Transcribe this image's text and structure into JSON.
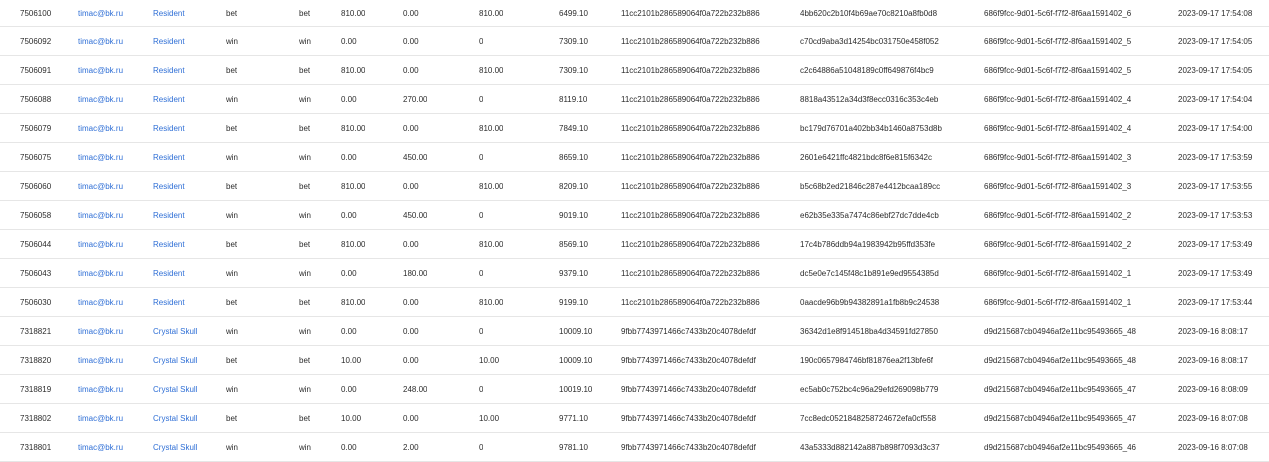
{
  "colors": {
    "link": "#2f6fd6",
    "text": "#2c2c2c",
    "divider": "#e6e6e6"
  },
  "rows": [
    {
      "id": "7506100",
      "email": "timac@bk.ru",
      "game": "Resident",
      "type": "bet",
      "action": "bet",
      "bet": "810.00",
      "win": "0.00",
      "debit": "810.00",
      "balance": "6499.10",
      "session": "11cc2101b286589064f0a722b232b886",
      "tx": "4bb620c2b10f4b69ae70c8210a8fb0d8",
      "round": "686f9fcc-9d01-5c6f-f7f2-8f6aa1591402_6",
      "date": "2023-09-17 17:54:08"
    },
    {
      "id": "7506092",
      "email": "timac@bk.ru",
      "game": "Resident",
      "type": "win",
      "action": "win",
      "bet": "0.00",
      "win": "0.00",
      "debit": "0",
      "balance": "7309.10",
      "session": "11cc2101b286589064f0a722b232b886",
      "tx": "c70cd9aba3d14254bc031750e458f052",
      "round": "686f9fcc-9d01-5c6f-f7f2-8f6aa1591402_5",
      "date": "2023-09-17 17:54:05"
    },
    {
      "id": "7506091",
      "email": "timac@bk.ru",
      "game": "Resident",
      "type": "bet",
      "action": "bet",
      "bet": "810.00",
      "win": "0.00",
      "debit": "810.00",
      "balance": "7309.10",
      "session": "11cc2101b286589064f0a722b232b886",
      "tx": "c2c64886a51048189c0ff649876f4bc9",
      "round": "686f9fcc-9d01-5c6f-f7f2-8f6aa1591402_5",
      "date": "2023-09-17 17:54:05"
    },
    {
      "id": "7506088",
      "email": "timac@bk.ru",
      "game": "Resident",
      "type": "win",
      "action": "win",
      "bet": "0.00",
      "win": "270.00",
      "debit": "0",
      "balance": "8119.10",
      "session": "11cc2101b286589064f0a722b232b886",
      "tx": "8818a43512a34d3f8ecc0316c353c4eb",
      "round": "686f9fcc-9d01-5c6f-f7f2-8f6aa1591402_4",
      "date": "2023-09-17 17:54:04"
    },
    {
      "id": "7506079",
      "email": "timac@bk.ru",
      "game": "Resident",
      "type": "bet",
      "action": "bet",
      "bet": "810.00",
      "win": "0.00",
      "debit": "810.00",
      "balance": "7849.10",
      "session": "11cc2101b286589064f0a722b232b886",
      "tx": "bc179d76701a402bb34b1460a8753d8b",
      "round": "686f9fcc-9d01-5c6f-f7f2-8f6aa1591402_4",
      "date": "2023-09-17 17:54:00"
    },
    {
      "id": "7506075",
      "email": "timac@bk.ru",
      "game": "Resident",
      "type": "win",
      "action": "win",
      "bet": "0.00",
      "win": "450.00",
      "debit": "0",
      "balance": "8659.10",
      "session": "11cc2101b286589064f0a722b232b886",
      "tx": "2601e6421ffc4821bdc8f6e815f6342c",
      "round": "686f9fcc-9d01-5c6f-f7f2-8f6aa1591402_3",
      "date": "2023-09-17 17:53:59"
    },
    {
      "id": "7506060",
      "email": "timac@bk.ru",
      "game": "Resident",
      "type": "bet",
      "action": "bet",
      "bet": "810.00",
      "win": "0.00",
      "debit": "810.00",
      "balance": "8209.10",
      "session": "11cc2101b286589064f0a722b232b886",
      "tx": "b5c68b2ed21846c287e4412bcaa189cc",
      "round": "686f9fcc-9d01-5c6f-f7f2-8f6aa1591402_3",
      "date": "2023-09-17 17:53:55"
    },
    {
      "id": "7506058",
      "email": "timac@bk.ru",
      "game": "Resident",
      "type": "win",
      "action": "win",
      "bet": "0.00",
      "win": "450.00",
      "debit": "0",
      "balance": "9019.10",
      "session": "11cc2101b286589064f0a722b232b886",
      "tx": "e62b35e335a7474c86ebf27dc7dde4cb",
      "round": "686f9fcc-9d01-5c6f-f7f2-8f6aa1591402_2",
      "date": "2023-09-17 17:53:53"
    },
    {
      "id": "7506044",
      "email": "timac@bk.ru",
      "game": "Resident",
      "type": "bet",
      "action": "bet",
      "bet": "810.00",
      "win": "0.00",
      "debit": "810.00",
      "balance": "8569.10",
      "session": "11cc2101b286589064f0a722b232b886",
      "tx": "17c4b786ddb94a1983942b95ffd353fe",
      "round": "686f9fcc-9d01-5c6f-f7f2-8f6aa1591402_2",
      "date": "2023-09-17 17:53:49"
    },
    {
      "id": "7506043",
      "email": "timac@bk.ru",
      "game": "Resident",
      "type": "win",
      "action": "win",
      "bet": "0.00",
      "win": "180.00",
      "debit": "0",
      "balance": "9379.10",
      "session": "11cc2101b286589064f0a722b232b886",
      "tx": "dc5e0e7c145f48c1b891e9ed9554385d",
      "round": "686f9fcc-9d01-5c6f-f7f2-8f6aa1591402_1",
      "date": "2023-09-17 17:53:49"
    },
    {
      "id": "7506030",
      "email": "timac@bk.ru",
      "game": "Resident",
      "type": "bet",
      "action": "bet",
      "bet": "810.00",
      "win": "0.00",
      "debit": "810.00",
      "balance": "9199.10",
      "session": "11cc2101b286589064f0a722b232b886",
      "tx": "0aacde96b9b94382891a1fb8b9c24538",
      "round": "686f9fcc-9d01-5c6f-f7f2-8f6aa1591402_1",
      "date": "2023-09-17 17:53:44"
    },
    {
      "id": "7318821",
      "email": "timac@bk.ru",
      "game": "Crystal Skull",
      "type": "win",
      "action": "win",
      "bet": "0.00",
      "win": "0.00",
      "debit": "0",
      "balance": "10009.10",
      "session": "9fbb7743971466c7433b20c4078defdf",
      "tx": "36342d1e8f914518ba4d34591fd27850",
      "round": "d9d215687cb04946af2e11bc95493665_48",
      "date": "2023-09-16 8:08:17"
    },
    {
      "id": "7318820",
      "email": "timac@bk.ru",
      "game": "Crystal Skull",
      "type": "bet",
      "action": "bet",
      "bet": "10.00",
      "win": "0.00",
      "debit": "10.00",
      "balance": "10009.10",
      "session": "9fbb7743971466c7433b20c4078defdf",
      "tx": "190c0657984746bf81876ea2f13bfe6f",
      "round": "d9d215687cb04946af2e11bc95493665_48",
      "date": "2023-09-16 8:08:17"
    },
    {
      "id": "7318819",
      "email": "timac@bk.ru",
      "game": "Crystal Skull",
      "type": "win",
      "action": "win",
      "bet": "0.00",
      "win": "248.00",
      "debit": "0",
      "balance": "10019.10",
      "session": "9fbb7743971466c7433b20c4078defdf",
      "tx": "ec5ab0c752bc4c96a29efd269098b779",
      "round": "d9d215687cb04946af2e11bc95493665_47",
      "date": "2023-09-16 8:08:09"
    },
    {
      "id": "7318802",
      "email": "timac@bk.ru",
      "game": "Crystal Skull",
      "type": "bet",
      "action": "bet",
      "bet": "10.00",
      "win": "0.00",
      "debit": "10.00",
      "balance": "9771.10",
      "session": "9fbb7743971466c7433b20c4078defdf",
      "tx": "7cc8edc0521848258724672efa0cf558",
      "round": "d9d215687cb04946af2e11bc95493665_47",
      "date": "2023-09-16 8:07:08"
    },
    {
      "id": "7318801",
      "email": "timac@bk.ru",
      "game": "Crystal Skull",
      "type": "win",
      "action": "win",
      "bet": "0.00",
      "win": "2.00",
      "debit": "0",
      "balance": "9781.10",
      "session": "9fbb7743971466c7433b20c4078defdf",
      "tx": "43a5333d882142a887b898f7093d3c37",
      "round": "d9d215687cb04946af2e11bc95493665_46",
      "date": "2023-09-16 8:07:08"
    }
  ]
}
